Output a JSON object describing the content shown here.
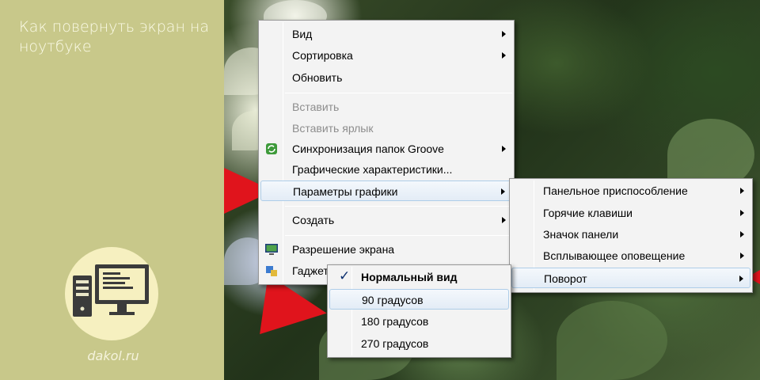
{
  "article": {
    "title": "Как повернуть экран на ноутбуке",
    "site": "dakol.ru"
  },
  "colors": {
    "panel_bg": "#c8c88a",
    "arrow": "#e0141c",
    "menu_bg": "#f3f3f3",
    "highlight_border": "#aecde8"
  },
  "context_menu": {
    "items": [
      {
        "label": "Вид",
        "submenu": true
      },
      {
        "label": "Сортировка",
        "submenu": true
      },
      {
        "label": "Обновить",
        "submenu": false
      },
      {
        "label": "Вставить",
        "disabled": true
      },
      {
        "label": "Вставить ярлык",
        "disabled": true
      },
      {
        "label": "Синхронизация папок Groove",
        "submenu": true,
        "icon": "groove-sync-icon"
      },
      {
        "label": "Графические характеристики...",
        "submenu": false
      },
      {
        "label": "Параметры графики",
        "submenu": true,
        "highlighted": true
      },
      {
        "label": "Создать",
        "submenu": true
      },
      {
        "label": "Разрешение экрана",
        "icon": "screen-resolution-icon"
      },
      {
        "label": "Гаджеты",
        "icon": "gadgets-icon"
      }
    ]
  },
  "graphics_submenu": {
    "items": [
      {
        "label": "Панельное приспособление",
        "submenu": true
      },
      {
        "label": "Горячие клавиши",
        "submenu": true
      },
      {
        "label": "Значок панели",
        "submenu": true
      },
      {
        "label": "Всплывающее оповещение",
        "submenu": true
      },
      {
        "label": "Поворот",
        "submenu": true,
        "highlighted": true
      }
    ]
  },
  "rotation_submenu": {
    "items": [
      {
        "label": "Нормальный вид",
        "checked": true
      },
      {
        "label": "90 градусов",
        "highlighted": true
      },
      {
        "label": "180 градусов"
      },
      {
        "label": "270 градусов"
      }
    ]
  }
}
